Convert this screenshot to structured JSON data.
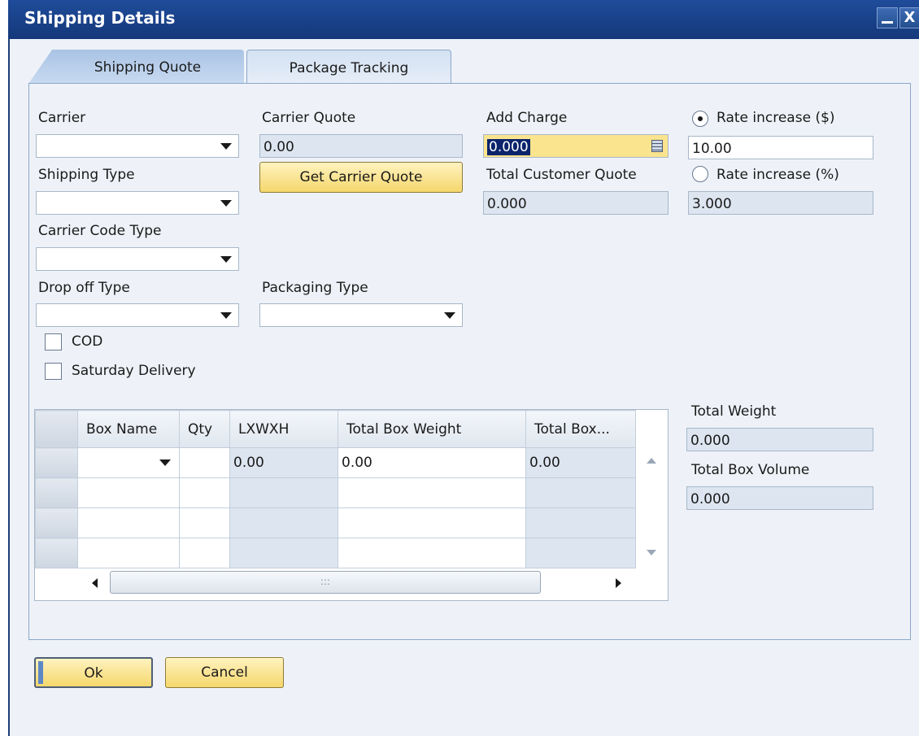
{
  "window": {
    "title": "Shipping Details",
    "minimize_glyph": "_",
    "close_glyph": "X"
  },
  "tabs": [
    {
      "label": "Shipping Quote",
      "active": true
    },
    {
      "label": "Package Tracking",
      "active": false
    }
  ],
  "form": {
    "carrier": {
      "label": "Carrier",
      "value": ""
    },
    "shipping_type": {
      "label": "Shipping Type",
      "value": ""
    },
    "carrier_code_type": {
      "label": "Carrier Code Type",
      "value": ""
    },
    "drop_off_type": {
      "label": "Drop off Type",
      "value": ""
    },
    "packaging_type": {
      "label": "Packaging Type",
      "value": ""
    },
    "carrier_quote": {
      "label": "Carrier Quote",
      "value": "0.00"
    },
    "get_carrier_quote_button": "Get Carrier Quote",
    "add_charge": {
      "label": "Add Charge",
      "value": "0.000"
    },
    "total_customer_quote": {
      "label": "Total Customer Quote",
      "value": "0.000"
    },
    "rate_increase_amount": {
      "label": "Rate increase ($)",
      "value": "10.00",
      "selected": true
    },
    "rate_increase_percent": {
      "label": "Rate increase (%)",
      "value": "3.000",
      "selected": false
    },
    "cod": {
      "label": "COD",
      "checked": false
    },
    "saturday_delivery": {
      "label": "Saturday Delivery",
      "checked": false
    }
  },
  "grid": {
    "columns": [
      "Box Name",
      "Qty",
      "LXWXH",
      "Total Box Weight",
      "Total Box..."
    ],
    "rows": [
      [
        "",
        "",
        "0.00",
        "0.00",
        "0.00"
      ],
      [
        "",
        "",
        "",
        "",
        ""
      ],
      [
        "",
        "",
        "",
        "",
        ""
      ],
      [
        "",
        "",
        "",
        "",
        ""
      ]
    ],
    "scroll_thumb_glyph": ":::"
  },
  "totals": {
    "total_weight": {
      "label": "Total Weight",
      "value": "0.000"
    },
    "total_box_volume": {
      "label": "Total Box Volume",
      "value": "0.000"
    }
  },
  "footer": {
    "ok_label": "Ok",
    "cancel_label": "Cancel"
  },
  "colors": {
    "titlebar": "#1f4c9a",
    "button_yellow": "#f5d76c",
    "focused_field": "#fbe48e",
    "readonly_field": "#dce5f0"
  }
}
